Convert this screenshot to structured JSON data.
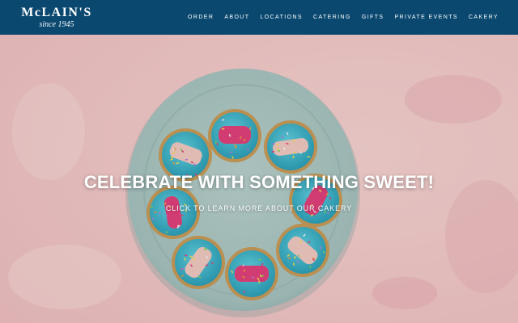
{
  "header": {
    "logo_text": "McLAIN'S",
    "logo_sub": "since 1945",
    "nav": [
      "ORDER",
      "ABOUT",
      "LOCATIONS",
      "CATERING",
      "GIFTS",
      "PRIVATE EVENTS",
      "CAKERY"
    ]
  },
  "hero": {
    "title": "CELEBRATE WITH SOMETHING SWEET!",
    "link": "CLICK TO LEARN MORE ABOUT OUR CAKERY"
  },
  "colors": {
    "header_bg": "#0a4870",
    "background_pink": "#f2c9c9",
    "plate": "#a9c7c3",
    "frosting": "#35b3c9",
    "cookie_pink": "#e0407a"
  }
}
